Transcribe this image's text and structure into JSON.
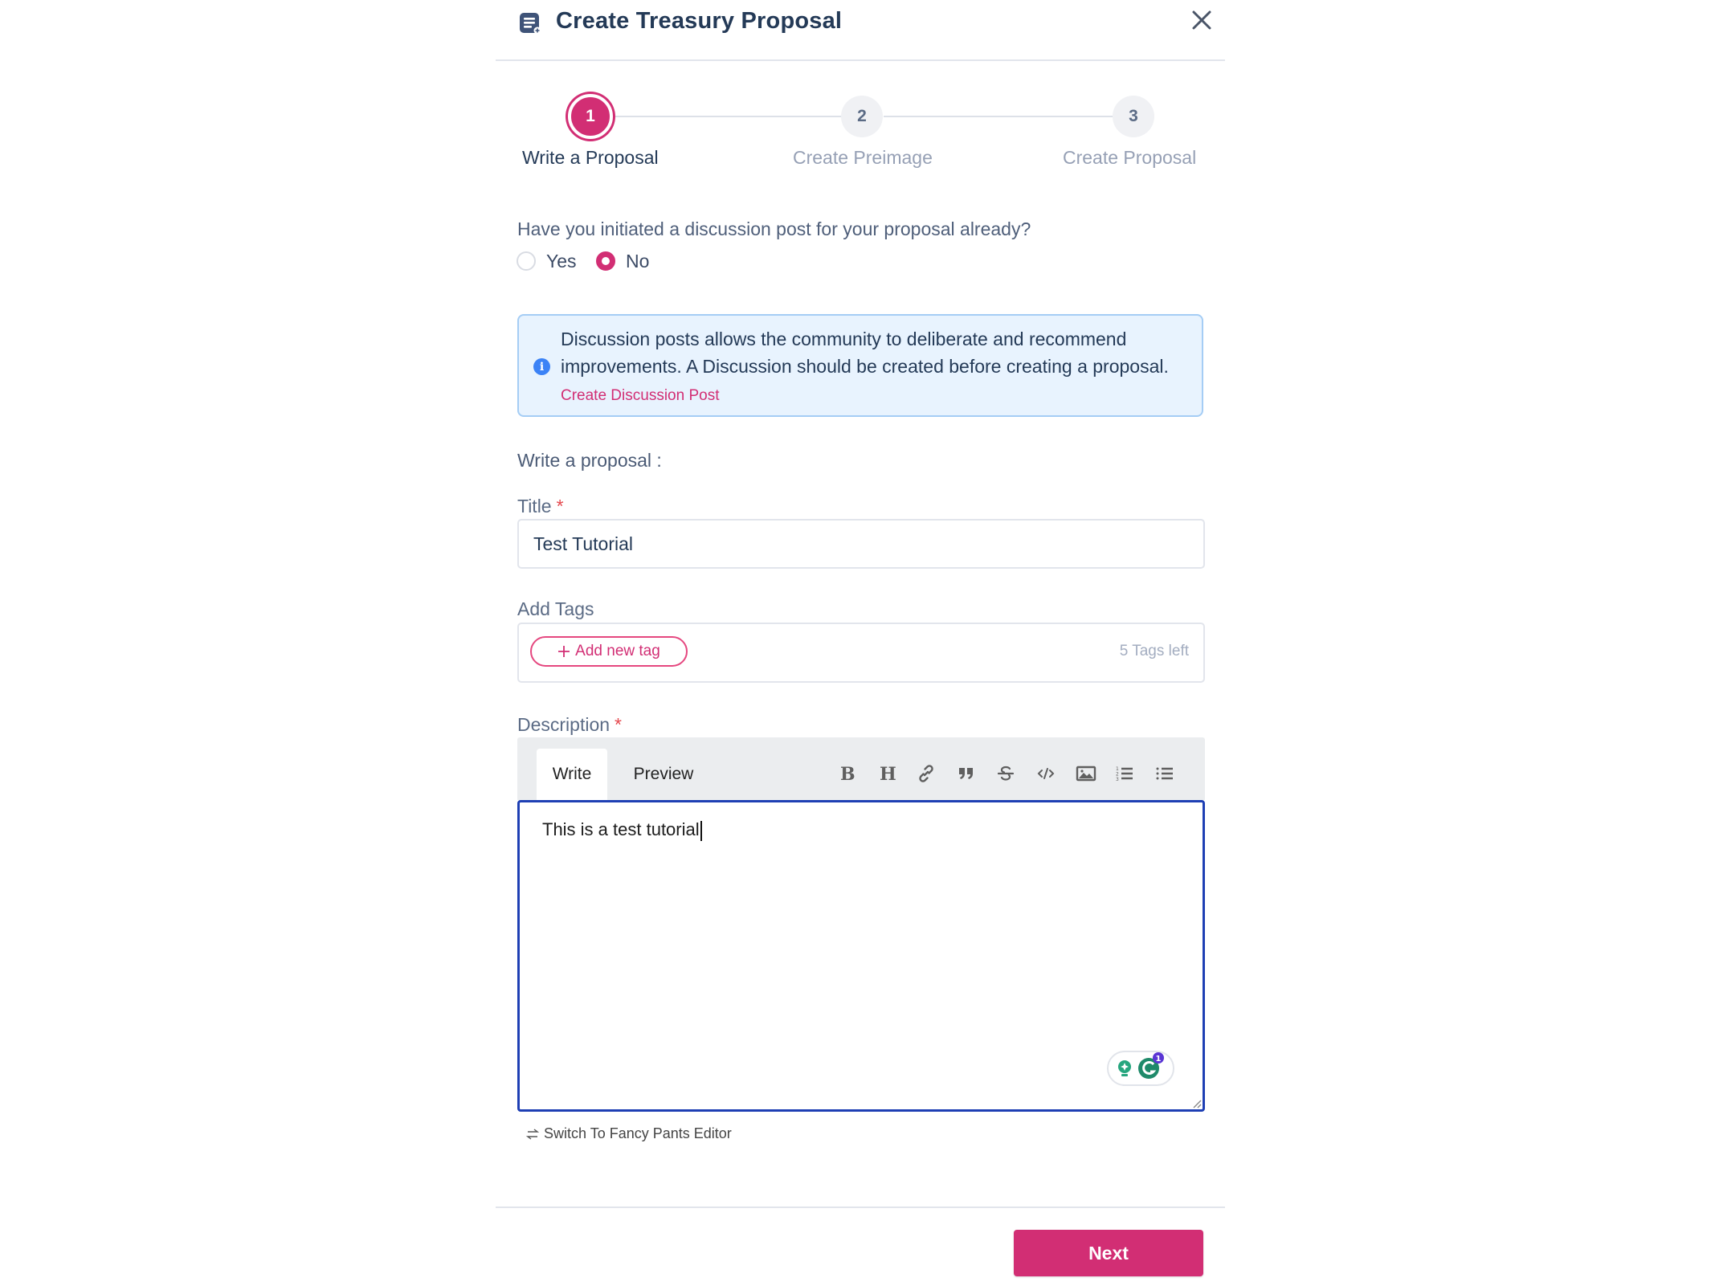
{
  "modal": {
    "title": "Create Treasury Proposal",
    "header_icon": "document-icon",
    "close_icon": "close-icon"
  },
  "stepper": {
    "steps": [
      {
        "number": "1",
        "label": "Write a Proposal",
        "state": "active"
      },
      {
        "number": "2",
        "label": "Create Preimage",
        "state": "inactive"
      },
      {
        "number": "3",
        "label": "Create Proposal",
        "state": "inactive"
      }
    ]
  },
  "discussion_question": {
    "label": "Have you initiated a discussion post for your proposal already?",
    "options": [
      {
        "label": "Yes",
        "selected": false
      },
      {
        "label": "No",
        "selected": true
      }
    ]
  },
  "info_alert": {
    "icon": "info-icon",
    "text": "Discussion posts allows the community to deliberate and recommend improvements. A Discussion should be created before creating a proposal.",
    "link_label": "Create Discussion Post"
  },
  "form": {
    "section_label": "Write a proposal :",
    "title": {
      "label": "Title",
      "required_mark": "*",
      "value": "Test Tutorial"
    },
    "tags": {
      "label": "Add Tags",
      "add_button_label": "Add new tag",
      "add_icon": "plus-icon",
      "remaining_text": "5 Tags left"
    },
    "description": {
      "label": "Description",
      "required_mark": "*",
      "tabs": [
        {
          "label": "Write",
          "active": true
        },
        {
          "label": "Preview",
          "active": false
        }
      ],
      "toolbar_tools": [
        "bold",
        "heading",
        "link",
        "quote",
        "strikethrough",
        "code",
        "image",
        "ordered-list",
        "unordered-list"
      ],
      "value": "This is a test tutorial",
      "grammarly_badge_count": "1"
    },
    "switch_editor_label": "Switch To Fancy Pants Editor"
  },
  "footer": {
    "next_label": "Next"
  },
  "colors": {
    "accent": "#d22e74",
    "info_bg": "#e8f3fe",
    "info_border": "#a5cdf5",
    "focus_border": "#1e3fb4",
    "title_text": "#243a57"
  }
}
